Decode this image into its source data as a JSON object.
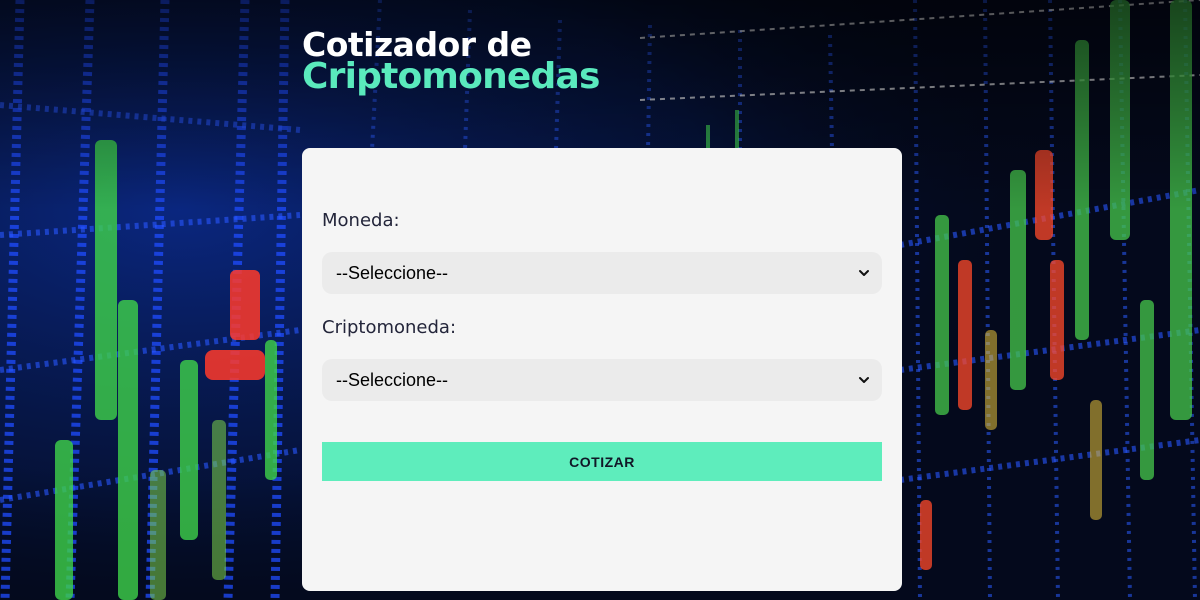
{
  "header": {
    "title_line1": "Cotizador de",
    "title_line2": "Criptomonedas"
  },
  "form": {
    "currency": {
      "label": "Moneda:",
      "selected": "--Seleccione--"
    },
    "crypto": {
      "label": "Criptomoneda:",
      "selected": "--Seleccione--"
    },
    "submit_label": "COTIZAR"
  },
  "icons": {
    "select_arrow": "chevron-down-icon"
  },
  "colors": {
    "accent": "#5eedbc",
    "title_accent": "#5aeabd",
    "card_bg": "#f5f5f5",
    "select_bg": "#ebebeb",
    "label_text": "#23253a"
  }
}
